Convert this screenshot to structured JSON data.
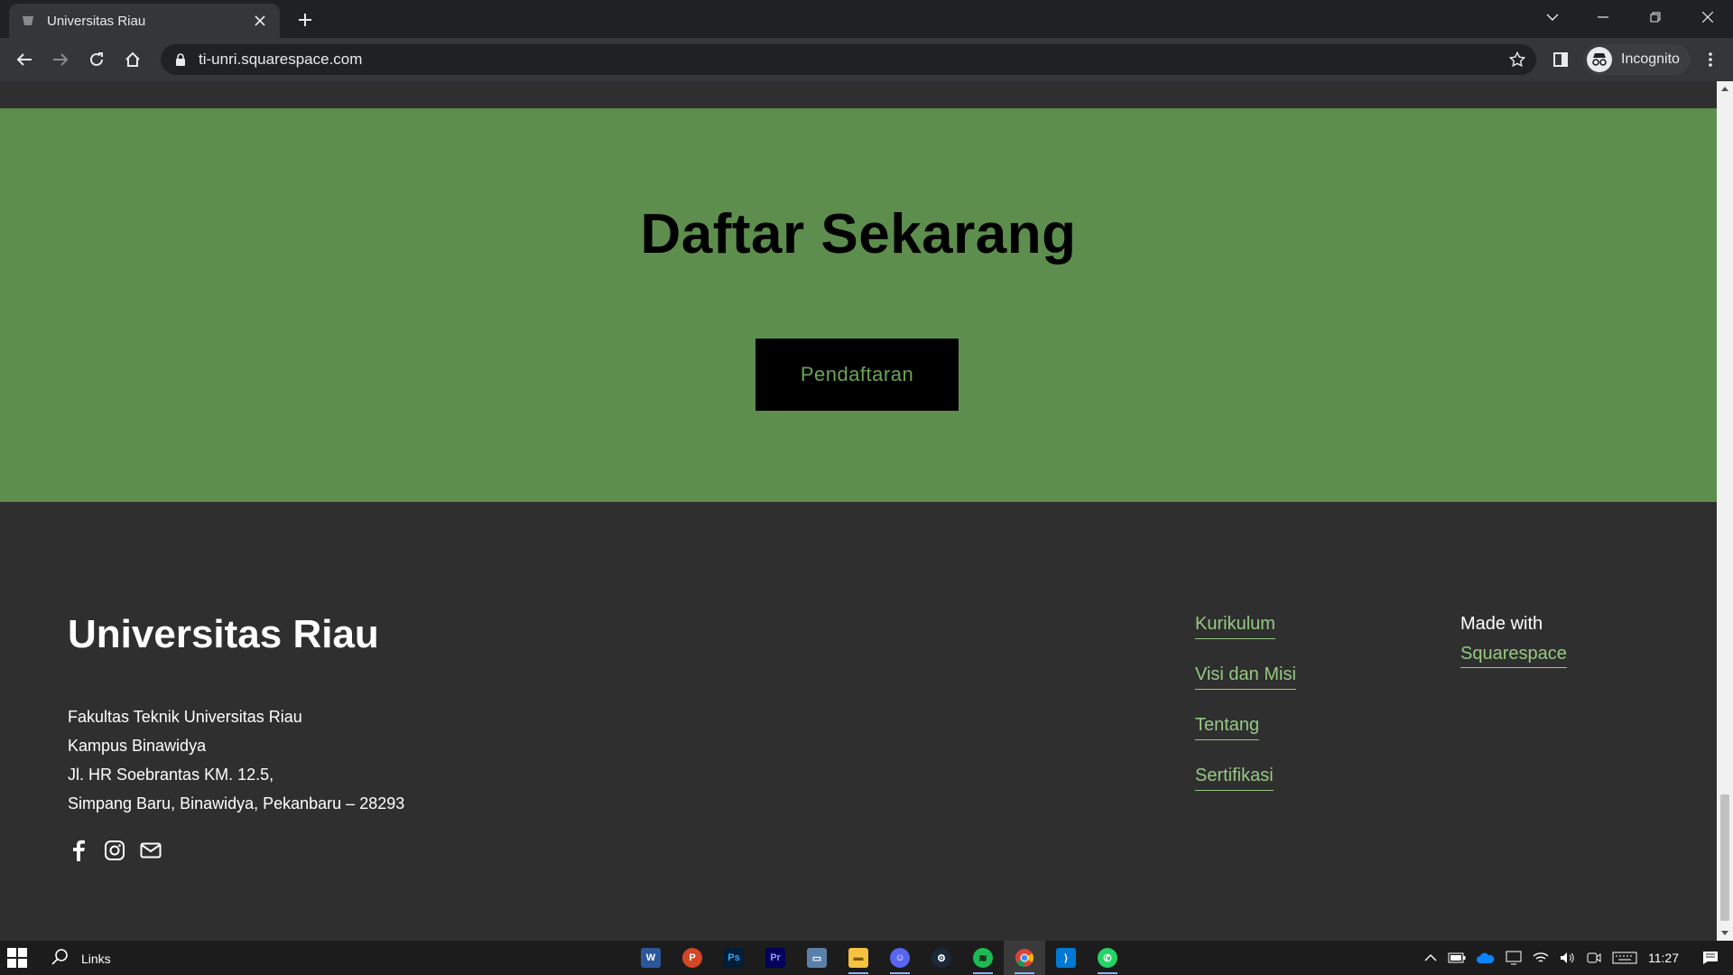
{
  "browser": {
    "tab_title": "Universitas Riau",
    "url": "ti-unri.squarespace.com",
    "profile_label": "Incognito"
  },
  "cta": {
    "heading": "Daftar Sekarang",
    "button_label": "Pendaftaran"
  },
  "footer": {
    "site_title": "Universitas Riau",
    "address": [
      "Fakultas Teknik Universitas Riau",
      "Kampus Binawidya",
      "Jl. HR Soebrantas KM. 12.5,",
      "Simpang Baru, Binawidya, Pekanbaru – 28293"
    ],
    "social_icons": [
      "facebook-icon",
      "instagram-icon",
      "email-icon"
    ],
    "nav_links": [
      "Kurikulum",
      "Visi dan Misi",
      "Tentang",
      "Sertifikasi"
    ],
    "made_with_label": "Made with",
    "made_with_link": "Squarespace"
  },
  "taskbar": {
    "search_label": "Links",
    "apps": [
      "word-icon",
      "powerpoint-icon",
      "photoshop-icon",
      "premiere-icon",
      "remote-desktop-icon",
      "file-explorer-icon",
      "discord-icon",
      "steam-icon",
      "spotify-icon",
      "chrome-icon",
      "vscode-icon",
      "whatsapp-icon"
    ],
    "clock": "11:27"
  },
  "colors": {
    "cta_background": "#5e8e4e",
    "link_green": "#96c983",
    "page_background": "#2f2f2f"
  }
}
